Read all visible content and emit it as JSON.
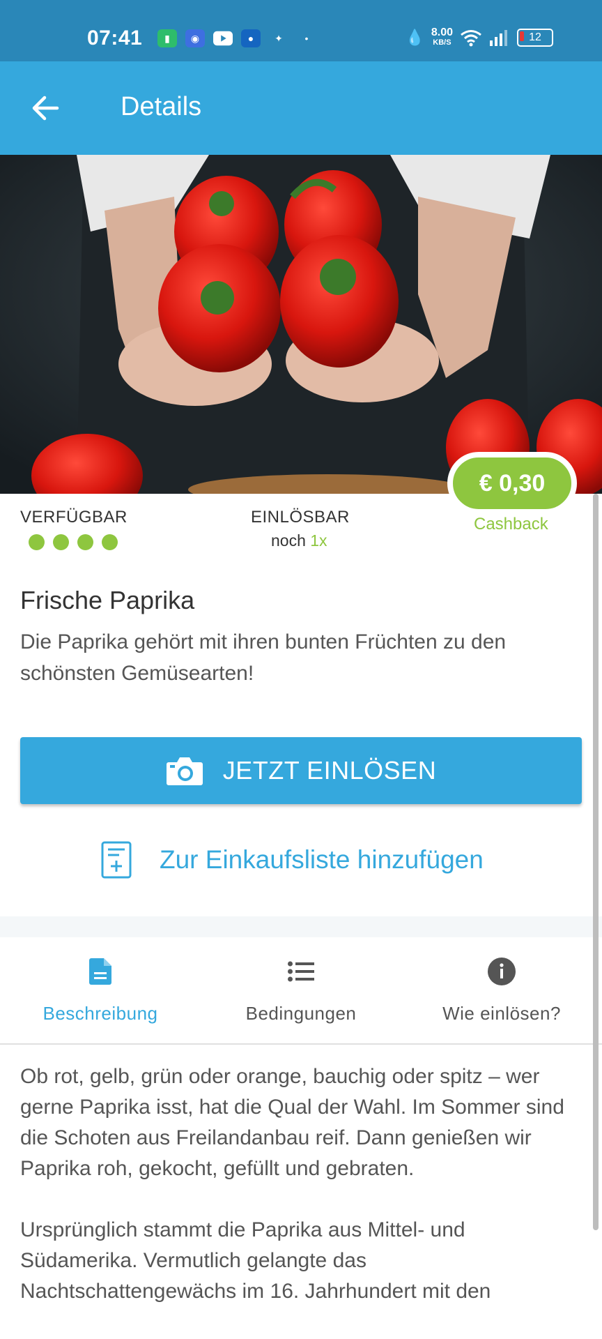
{
  "status_bar": {
    "time": "07:41",
    "speed_value": "8.00",
    "speed_unit": "KB/S",
    "battery": "12"
  },
  "header": {
    "title": "Details"
  },
  "offer": {
    "cashback_amount": "€ 0,30",
    "cashback_label": "Cashback",
    "available_label": "VERFÜGBAR",
    "available_level": 4,
    "redeemable_label": "EINLÖSBAR",
    "redeemable_prefix": "noch",
    "redeemable_count": "1x",
    "accent_color": "#8ec63f"
  },
  "product": {
    "title": "Frische Paprika",
    "subtitle": "Die Paprika gehört mit ihren bunten Früchten zu den schönsten Gemüsearten!"
  },
  "actions": {
    "redeem_label": "JETZT EINLÖSEN",
    "add_to_list_label": "Zur Einkaufsliste hinzufügen",
    "primary_color": "#35a8dd"
  },
  "tabs": [
    {
      "label": "Beschreibung",
      "icon": "document-icon",
      "active": true
    },
    {
      "label": "Bedingungen",
      "icon": "list-icon",
      "active": false
    },
    {
      "label": "Wie einlösen?",
      "icon": "info-icon",
      "active": false
    }
  ],
  "description": {
    "paragraph1": "Ob rot, gelb, grün oder orange, bauchig oder spitz – wer gerne Paprika isst, hat die Qual der Wahl. Im Sommer sind die Schoten aus Freilandanbau reif. Dann genießen wir Paprika roh, gekocht, gefüllt und gebraten.",
    "paragraph2": "Ursprünglich stammt die Paprika aus Mittel- und Südamerika. Vermutlich gelangte das Nachtschattengewächs im 16. Jahrhundert mit den"
  }
}
